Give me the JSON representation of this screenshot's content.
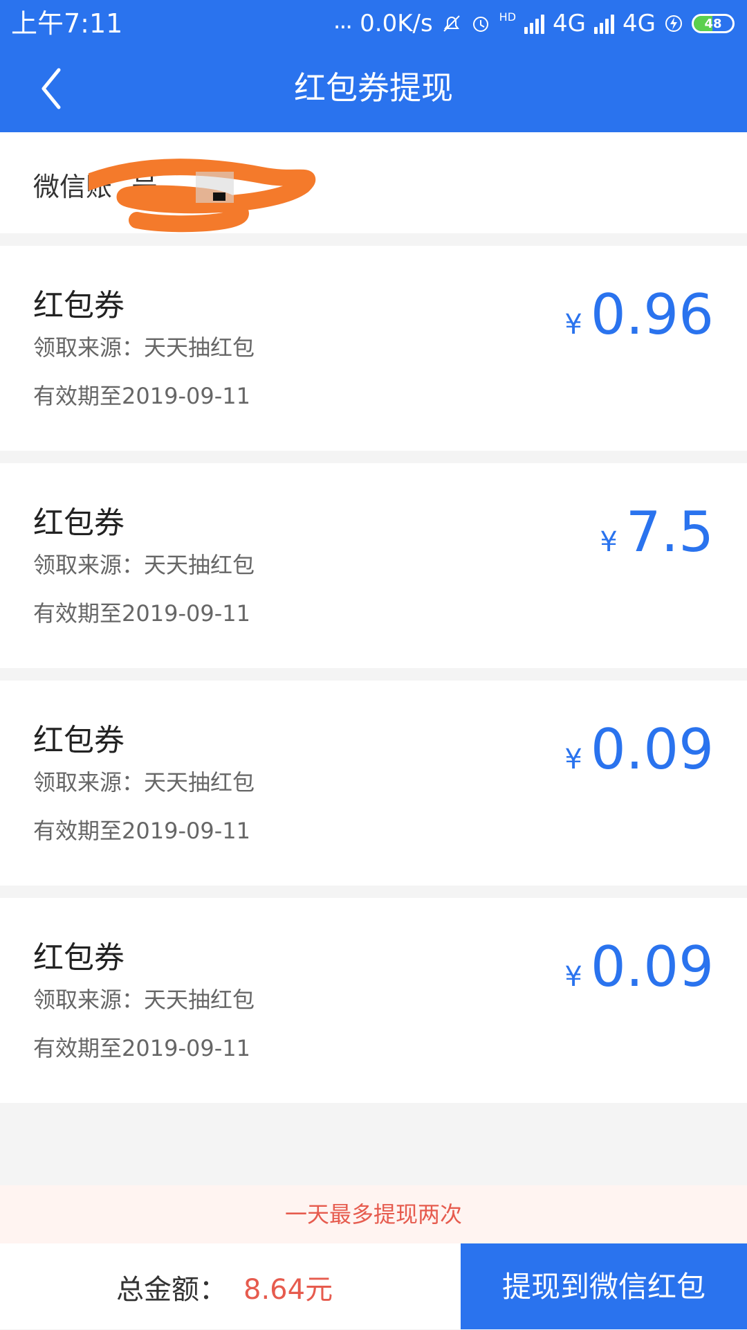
{
  "status_bar": {
    "time": "上午7:11",
    "dots": "...",
    "network_speed": "0.0K/s",
    "hd": "HD",
    "signal_1": "4G",
    "signal_2": "4G",
    "battery": "48",
    "battery_level": 48
  },
  "header": {
    "title": "红包券提现"
  },
  "account": {
    "label": "微信账",
    "value": "号"
  },
  "coupons": [
    {
      "title": "红包券",
      "source": "领取来源：天天抽红包",
      "expiry": "有效期至2019-09-11",
      "currency": "¥",
      "amount": "0.96"
    },
    {
      "title": "红包券",
      "source": "领取来源：天天抽红包",
      "expiry": "有效期至2019-09-11",
      "currency": "¥",
      "amount": "7.5"
    },
    {
      "title": "红包券",
      "source": "领取来源：天天抽红包",
      "expiry": "有效期至2019-09-11",
      "currency": "¥",
      "amount": "0.09"
    },
    {
      "title": "红包券",
      "source": "领取来源：天天抽红包",
      "expiry": "有效期至2019-09-11",
      "currency": "¥",
      "amount": "0.09"
    }
  ],
  "notice": {
    "text": "一天最多提现两次"
  },
  "footer": {
    "total_label": "总金额：",
    "total_value": "8.64元",
    "withdraw_label": "提现到微信红包"
  },
  "colors": {
    "brand_blue": "#2a73ee",
    "notice_red": "#e65b4e",
    "notice_bg": "#fff4f1",
    "redaction_orange": "#f47a2b"
  }
}
